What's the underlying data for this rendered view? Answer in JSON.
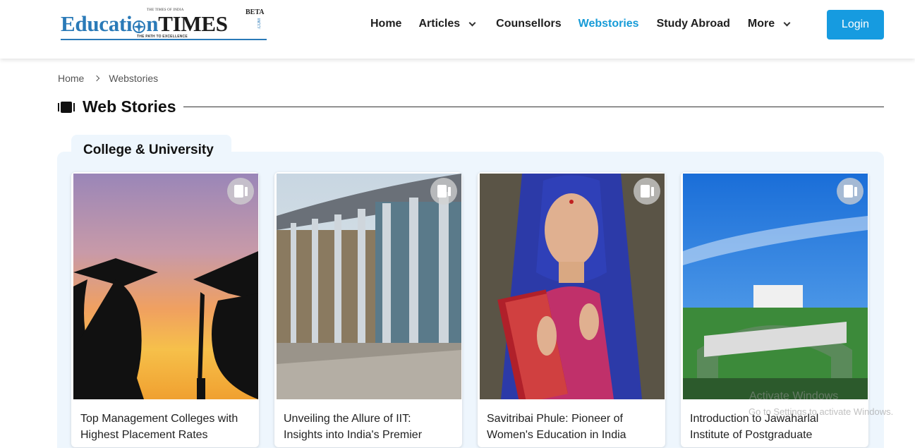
{
  "logo": {
    "top_small": "THE TIMES OF INDIA",
    "word1": "Educati",
    "word2": "n",
    "word3": "TIMES",
    "beta": "BETA",
    "com": ".COM",
    "tagline": "THE PATH TO EXCELLENCE"
  },
  "nav": {
    "items": [
      {
        "label": "Home"
      },
      {
        "label": "Articles"
      },
      {
        "label": "Counsellors"
      },
      {
        "label": "Webstories"
      },
      {
        "label": "Study Abroad"
      },
      {
        "label": "More"
      }
    ],
    "login": "Login",
    "active_color": "#169bd7",
    "button_color": "#169be0"
  },
  "breadcrumb": {
    "items": [
      "Home",
      "Webstories"
    ]
  },
  "section": {
    "title": "Web Stories",
    "category": "College & University"
  },
  "cards": [
    {
      "title": "Top Management Colleges with Highest Placement Rates",
      "image": "graduates-silhouette-sunset",
      "icon": "web-story-icon"
    },
    {
      "title": "Unveiling the Allure of IIT: Insights into India's Premier",
      "image": "iit-building-columns",
      "icon": "web-story-icon"
    },
    {
      "title": "Savitribai Phule: Pioneer of Women's Education in India",
      "image": "savitribai-phule-portrait",
      "icon": "web-story-icon"
    },
    {
      "title": "Introduction to Jawaharlal Institute of Postgraduate",
      "image": "jipmer-entrance-arch",
      "icon": "web-story-icon"
    }
  ],
  "watermark": {
    "line1": "Activate Windows",
    "line2": "Go to Settings to activate Windows."
  }
}
